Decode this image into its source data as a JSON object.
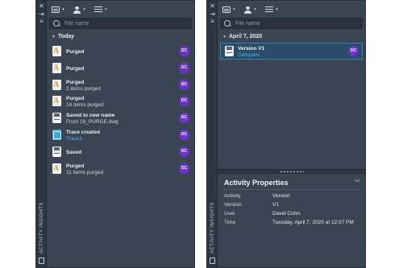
{
  "left": {
    "sidebar_title": "ACTIVITY INSIGHTS",
    "search_placeholder": "File name",
    "group": "Today",
    "items": [
      {
        "icon": "dwg-file-icon",
        "title": "Purged",
        "sub": "",
        "badge": "DC"
      },
      {
        "icon": "dwg-file-icon",
        "title": "Purged",
        "sub": "",
        "badge": "DC"
      },
      {
        "icon": "dwg-file-icon",
        "title": "Purged",
        "sub": "2 items purged",
        "badge": "DC"
      },
      {
        "icon": "dwg-file-icon",
        "title": "Purged",
        "sub": "14 items purged",
        "badge": "DC"
      },
      {
        "icon": "save-icon",
        "title": "Saved to new name",
        "sub": "From 19_PURGE.dwg",
        "badge": "DC"
      },
      {
        "icon": "trace-icon",
        "title": "Trace created",
        "sub": "Trace1",
        "badge": "DC"
      },
      {
        "icon": "save-icon",
        "title": "Saved",
        "sub": "",
        "badge": "DC"
      },
      {
        "icon": "dwg-file-icon",
        "title": "Purged",
        "sub": "11 items purged",
        "badge": "DC"
      }
    ]
  },
  "right": {
    "sidebar_title": "ACTIVITY INSIGHTS",
    "search_placeholder": "File name",
    "group": "April 7, 2020",
    "selected_item": {
      "icon": "save-icon",
      "title": "Version V1",
      "sub": "Compare",
      "badge": "DC"
    },
    "properties": {
      "title": "Activity Properties",
      "rows": [
        {
          "key": "Activity",
          "value": "Version"
        },
        {
          "key": "Version",
          "value": "V1"
        },
        {
          "key": "User",
          "value": "David Cohn"
        },
        {
          "key": "Time",
          "value": "Tuesday, April 7, 2020 at 12:07 PM"
        }
      ]
    }
  },
  "colors": {
    "panel_bg": "#3b4453",
    "badge": "#6b35c9",
    "link": "#4fb3e8",
    "selection": "#2b4c68"
  }
}
